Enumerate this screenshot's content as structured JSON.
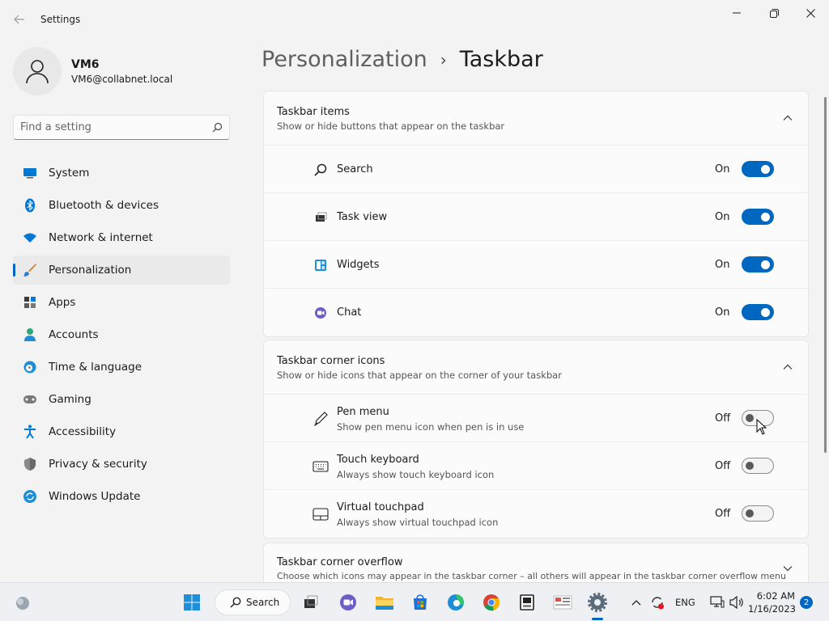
{
  "window": {
    "title": "Settings"
  },
  "profile": {
    "name": "VM6",
    "email": "VM6@collabnet.local"
  },
  "search": {
    "placeholder": "Find a setting"
  },
  "nav": [
    {
      "label": "System",
      "icon": "monitor-icon"
    },
    {
      "label": "Bluetooth & devices",
      "icon": "bluetooth-icon"
    },
    {
      "label": "Network & internet",
      "icon": "wifi-icon"
    },
    {
      "label": "Personalization",
      "icon": "brush-icon",
      "active": true
    },
    {
      "label": "Apps",
      "icon": "apps-icon"
    },
    {
      "label": "Accounts",
      "icon": "person-icon"
    },
    {
      "label": "Time & language",
      "icon": "globe-clock-icon"
    },
    {
      "label": "Gaming",
      "icon": "controller-icon"
    },
    {
      "label": "Accessibility",
      "icon": "accessibility-icon"
    },
    {
      "label": "Privacy & security",
      "icon": "shield-icon"
    },
    {
      "label": "Windows Update",
      "icon": "update-icon"
    }
  ],
  "breadcrumb": {
    "parent": "Personalization",
    "separator": "›",
    "current": "Taskbar"
  },
  "sections": {
    "items": {
      "title": "Taskbar items",
      "description": "Show or hide buttons that appear on the taskbar",
      "rows": [
        {
          "label": "Search",
          "state": "On",
          "on": true,
          "icon": "search-icon"
        },
        {
          "label": "Task view",
          "state": "On",
          "on": true,
          "icon": "task-view-icon"
        },
        {
          "label": "Widgets",
          "state": "On",
          "on": true,
          "icon": "widgets-icon"
        },
        {
          "label": "Chat",
          "state": "On",
          "on": true,
          "icon": "chat-icon"
        }
      ]
    },
    "corner": {
      "title": "Taskbar corner icons",
      "description": "Show or hide icons that appear on the corner of your taskbar",
      "rows": [
        {
          "label": "Pen menu",
          "sub": "Show pen menu icon when pen is in use",
          "state": "Off",
          "on": false,
          "icon": "pen-icon"
        },
        {
          "label": "Touch keyboard",
          "sub": "Always show touch keyboard icon",
          "state": "Off",
          "on": false,
          "icon": "keyboard-icon"
        },
        {
          "label": "Virtual touchpad",
          "sub": "Always show virtual touchpad icon",
          "state": "Off",
          "on": false,
          "icon": "touchpad-icon"
        }
      ]
    },
    "overflow": {
      "title": "Taskbar corner overflow",
      "description": "Choose which icons may appear in the taskbar corner – all others will appear in the taskbar corner overflow menu"
    }
  },
  "taskbar": {
    "search_label": "Search",
    "lang": "ENG",
    "time": "6:02 AM",
    "date": "1/16/2023",
    "notifications": "2"
  },
  "colors": {
    "accent": "#0067c0"
  }
}
